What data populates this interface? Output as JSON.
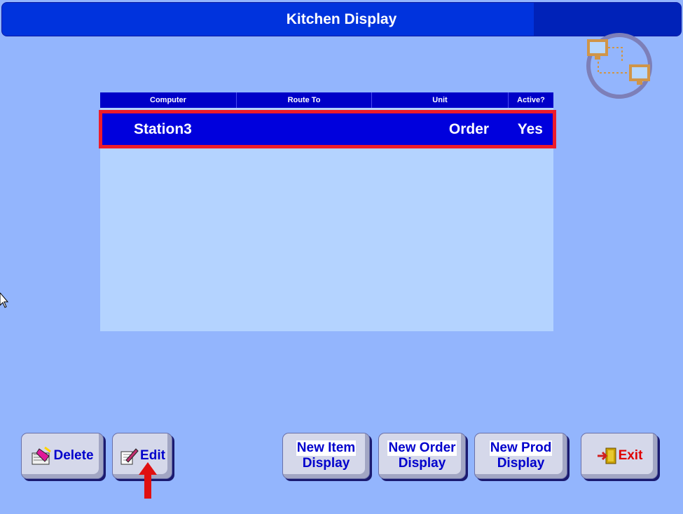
{
  "window": {
    "title": "Kitchen Display"
  },
  "table": {
    "columns": [
      "Computer",
      "Route To",
      "Unit",
      "Active?"
    ],
    "rows": [
      {
        "computer": "Station3",
        "route_to": "",
        "unit": "Order",
        "active": "Yes",
        "selected": true
      }
    ]
  },
  "buttons": {
    "delete": "Delete",
    "edit": "Edit",
    "new_item_line1": "New Item",
    "new_item_line2": "Display",
    "new_order_line1": "New Order",
    "new_order_line2": "Display",
    "new_prod_line1": "New Prod",
    "new_prod_line2": "Display",
    "exit": "Exit"
  },
  "colors": {
    "background": "#93b5fd",
    "titlebar": "#0033dd",
    "selection_row": "#0000dd",
    "selection_border": "#ee1c2a",
    "button_text": "#0000cc",
    "exit_text": "#e00000"
  },
  "icons": [
    "network-computers-icon",
    "delete-icon",
    "edit-icon",
    "exit-door-icon",
    "red-arrow-indicator",
    "mouse-cursor"
  ]
}
